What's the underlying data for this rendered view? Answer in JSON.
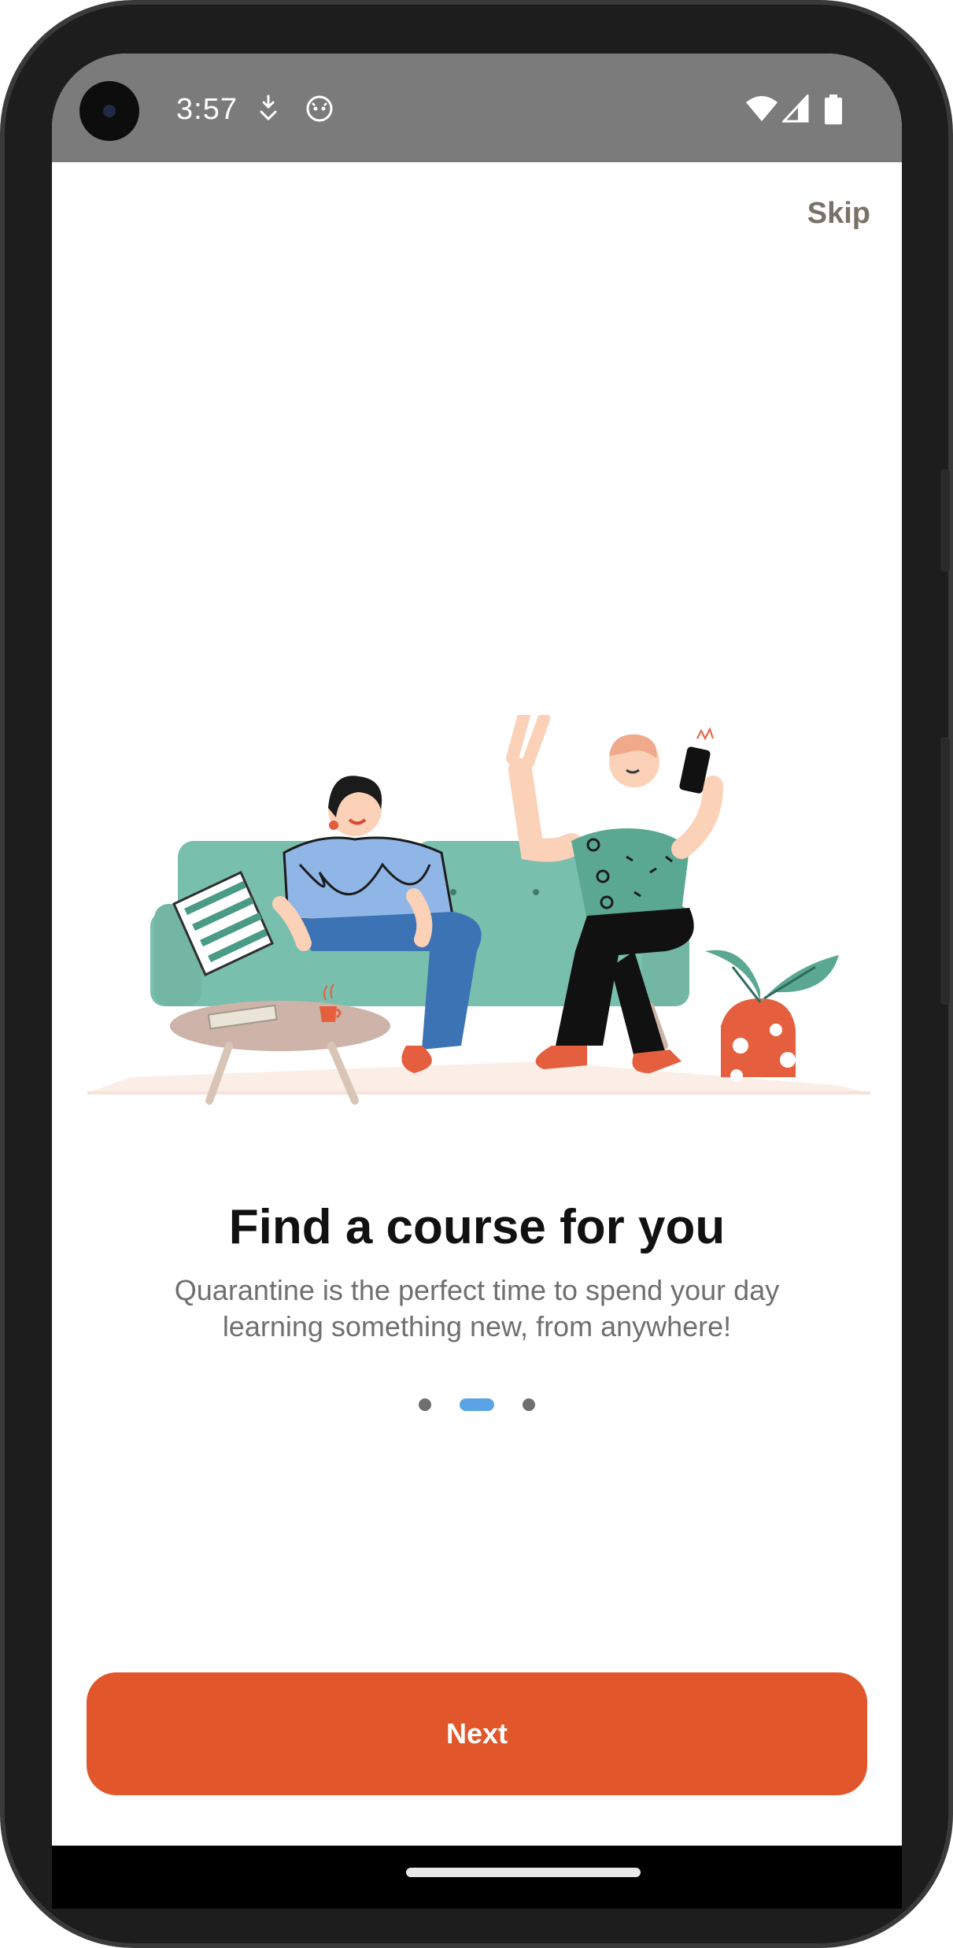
{
  "status_bar": {
    "time": "3:57"
  },
  "onboarding": {
    "skip_label": "Skip",
    "title": "Find a course for you",
    "subtitle": "Quarantine is the perfect time to spend your day learning something new, from anywhere!",
    "page_indicator": {
      "total": 3,
      "current": 2
    },
    "next_label": "Next"
  },
  "colors": {
    "accent": "#e1562b",
    "indicator_active": "#5aa3e6",
    "status_bar": "#7b7b7b"
  },
  "icons": [
    "camera-icon",
    "download-notification-icon",
    "android-notification-icon",
    "wifi-icon",
    "signal-icon",
    "battery-icon"
  ]
}
